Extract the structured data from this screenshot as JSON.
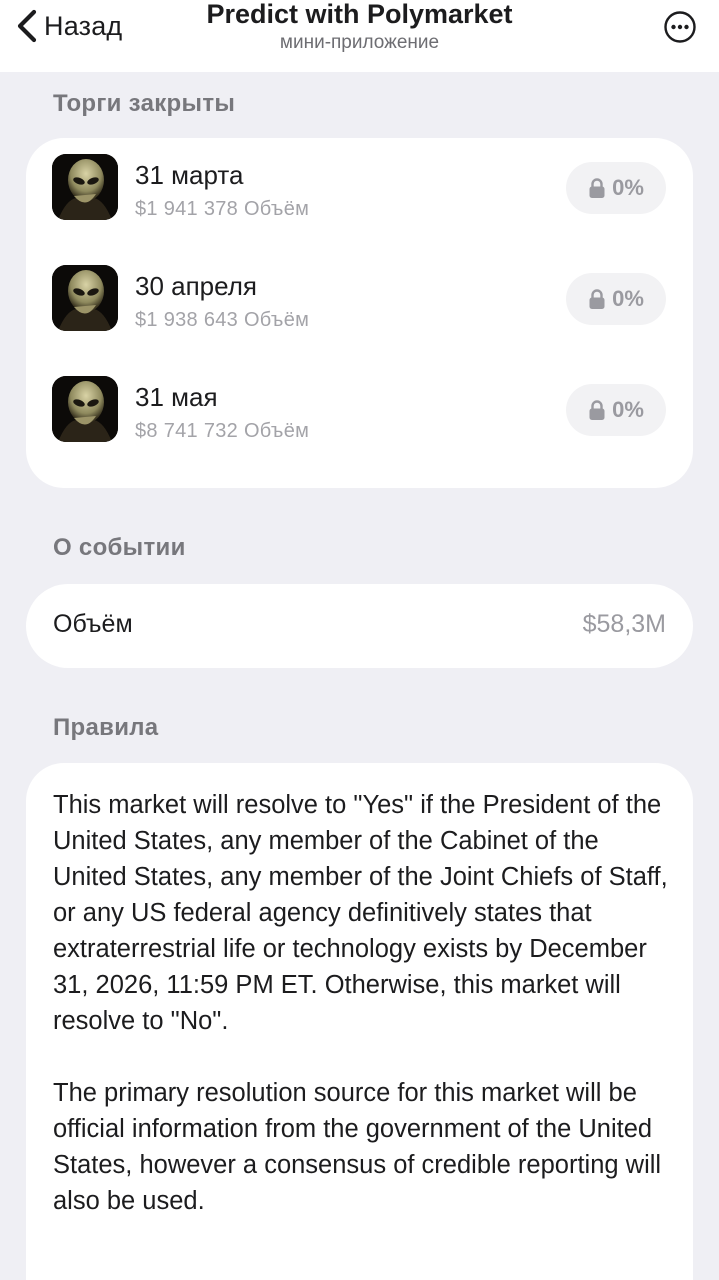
{
  "header": {
    "back_label": "Назад",
    "title": "Predict with Polymarket",
    "subtitle": "мини-приложение",
    "more_icon": "ellipsis-circle-icon"
  },
  "closed_section": {
    "title": "Торги закрыты",
    "markets": [
      {
        "name": "31 марта",
        "volume": "$1 941 378 Объём",
        "percent": "0%",
        "icon": "alien-avatar-image"
      },
      {
        "name": "30 апреля",
        "volume": "$1 938 643 Объём",
        "percent": "0%",
        "icon": "alien-avatar-image"
      },
      {
        "name": "31 мая",
        "volume": "$8 741 732 Объём",
        "percent": "0%",
        "icon": "alien-avatar-image"
      }
    ]
  },
  "about_section": {
    "title": "О событии",
    "volume_label": "Объём",
    "volume_value": "$58,3M"
  },
  "rules_section": {
    "title": "Правила",
    "paragraphs": [
      "This market will resolve to \"Yes\" if the President of the United States, any member of the Cabinet of the United States, any member of the Joint Chiefs of Staff, or any US federal agency definitively states that extraterrestrial life or technology exists by December 31, 2026, 11:59 PM ET. Otherwise, this market will resolve to \"No\".",
      "The primary resolution source for this market will be official information from the government of the United States, however a consensus of credible reporting will also be used."
    ]
  },
  "colors": {
    "background": "#efeff4",
    "card": "#ffffff",
    "section_title": "#77777c",
    "muted_text": "#a3a3a8",
    "pill_bg": "#f2f2f4"
  }
}
